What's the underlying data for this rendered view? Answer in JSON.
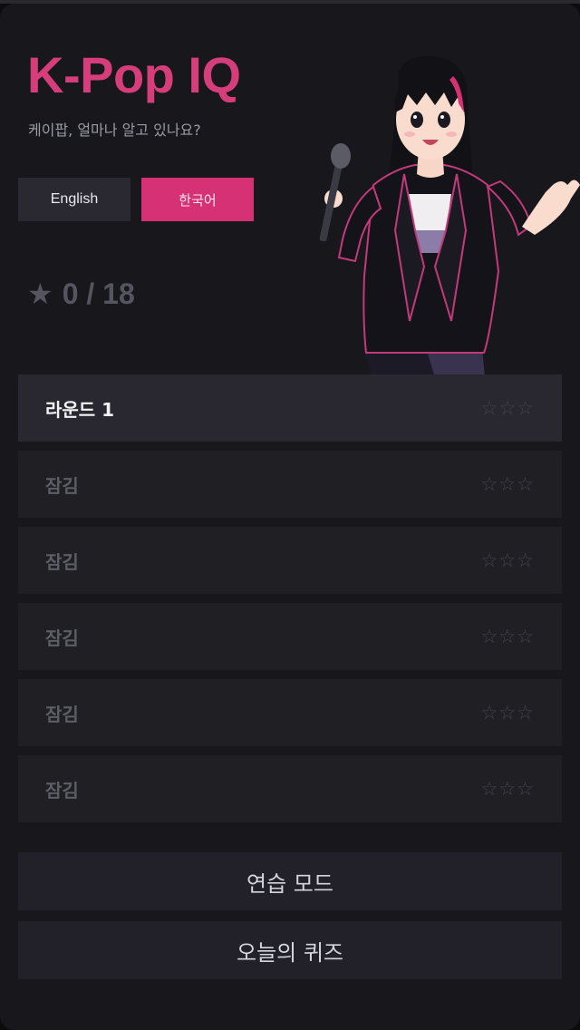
{
  "header": {
    "title": "K-Pop IQ",
    "subtitle": "케이팝, 얼마나 알고 있나요?"
  },
  "languages": [
    {
      "label": "English",
      "selected": false
    },
    {
      "label": "한국어",
      "selected": true
    }
  ],
  "score": {
    "icon": "star-icon",
    "text": "0 / 18"
  },
  "rounds": [
    {
      "label": "라운드 1",
      "stars": "☆☆☆",
      "locked": false
    },
    {
      "label": "잠김",
      "stars": "☆☆☆",
      "locked": true
    },
    {
      "label": "잠김",
      "stars": "☆☆☆",
      "locked": true
    },
    {
      "label": "잠김",
      "stars": "☆☆☆",
      "locked": true
    },
    {
      "label": "잠김",
      "stars": "☆☆☆",
      "locked": true
    },
    {
      "label": "잠김",
      "stars": "☆☆☆",
      "locked": true
    }
  ],
  "actions": {
    "practice": "연습 모드",
    "daily": "오늘의 퀴즈"
  },
  "colors": {
    "accent": "#d63175",
    "background": "#18181c",
    "panel": "#1f1f24"
  }
}
